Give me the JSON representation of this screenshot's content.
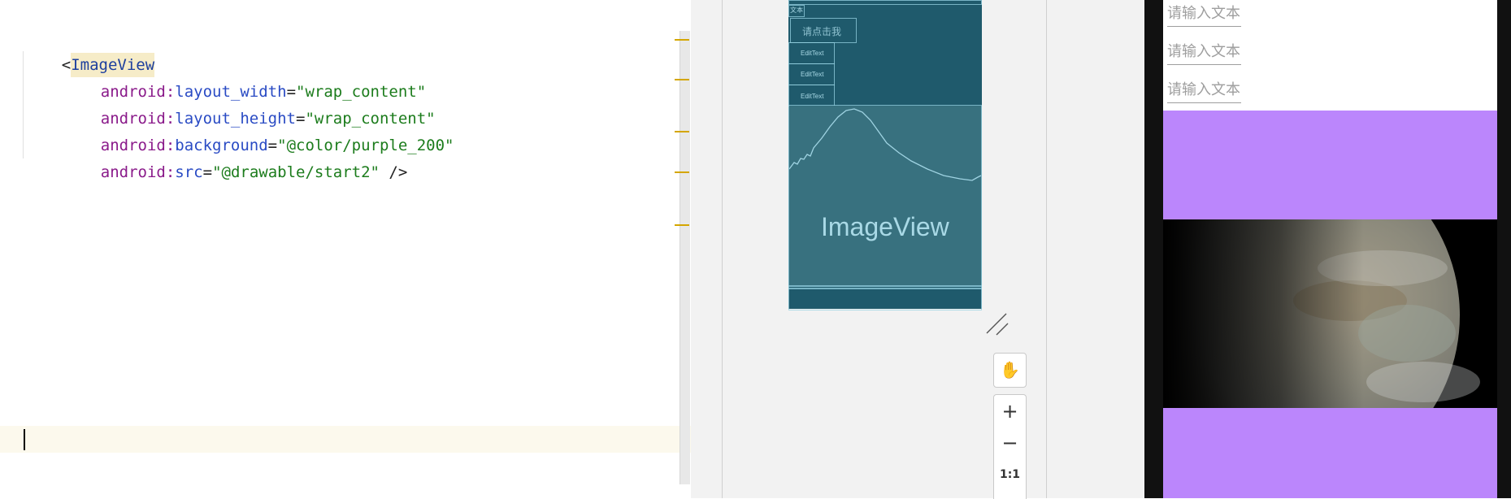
{
  "editor": {
    "lines": {
      "l1": {
        "open": "<",
        "tag": "ImageView"
      },
      "l2": {
        "ns": "android:",
        "attr": "layout_width",
        "eq": "=",
        "value": "\"wrap_content\""
      },
      "l3": {
        "ns": "android:",
        "attr": "layout_height",
        "eq": "=",
        "value": "\"wrap_content\""
      },
      "l4": {
        "ns": "android:",
        "attr": "background",
        "eq": "=",
        "value": "\"@color/purple_200\""
      },
      "l5": {
        "ns": "android:",
        "attr": "src",
        "eq": "=",
        "value": "\"@drawable/start2\"",
        "close": " />"
      }
    }
  },
  "design": {
    "blueprint": {
      "top_text": "文本",
      "button_label": "请点击我",
      "edittext_labels": [
        "EditText",
        "EditText",
        "EditText"
      ],
      "image_label": "ImageView"
    },
    "zoom": {
      "pan": "✋",
      "zoom_in": "+",
      "zoom_out": "−",
      "actual_size": "1:1"
    }
  },
  "emulator": {
    "edit_hints": [
      "请输入文本",
      "请输入文本",
      "请输入文本"
    ]
  },
  "colors": {
    "purple_200": "#bb86fc",
    "blueprint_bg": "#1f5a6c",
    "marker": "#d4a600"
  }
}
